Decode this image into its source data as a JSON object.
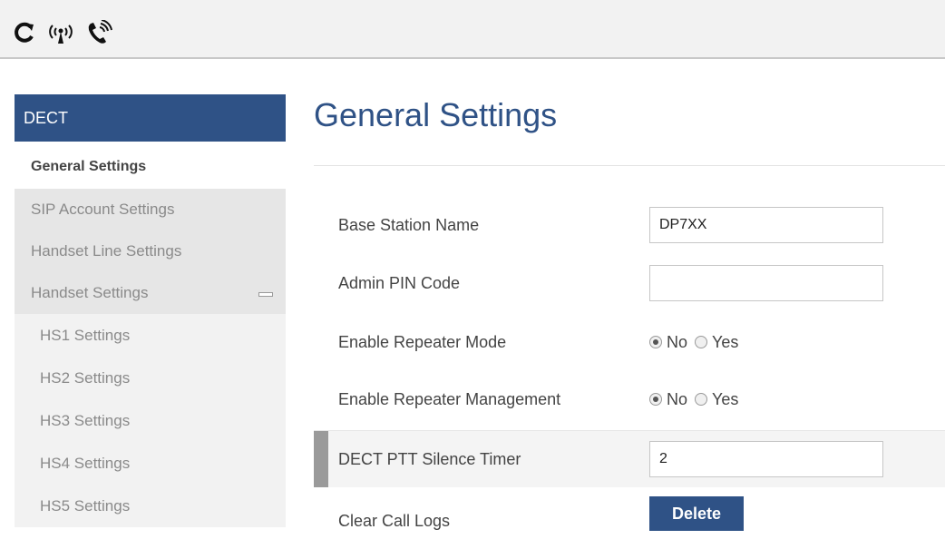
{
  "topbar": {
    "icons": [
      {
        "name": "refresh-icon",
        "glyph": "C"
      },
      {
        "name": "wireless-icon",
        "glyph": "((·))"
      },
      {
        "name": "phone-ring-icon",
        "glyph": "✆"
      }
    ]
  },
  "sidebar": {
    "header": "DECT",
    "active": "General Settings",
    "items": [
      "SIP Account Settings",
      "Handset Line Settings",
      "Handset Settings"
    ],
    "sub_items": [
      "HS1 Settings",
      "HS2 Settings",
      "HS3 Settings",
      "HS4 Settings",
      "HS5 Settings"
    ]
  },
  "main": {
    "title": "General Settings",
    "fields": {
      "base_station_name": {
        "label": "Base Station Name",
        "value": "DP7XX"
      },
      "admin_pin": {
        "label": "Admin PIN Code",
        "value": ""
      },
      "repeater_mode": {
        "label": "Enable Repeater Mode",
        "options": [
          "No",
          "Yes"
        ],
        "selected": "No"
      },
      "repeater_mgmt": {
        "label": "Enable Repeater Management",
        "options": [
          "No",
          "Yes"
        ],
        "selected": "No"
      },
      "ptt_timer": {
        "label": "DECT PTT Silence Timer",
        "value": "2"
      },
      "clear_logs": {
        "label": "Clear Call Logs",
        "button": "Delete"
      }
    }
  },
  "colors": {
    "accent": "#2f5286",
    "sidebar_gray": "#e6e6e6"
  }
}
